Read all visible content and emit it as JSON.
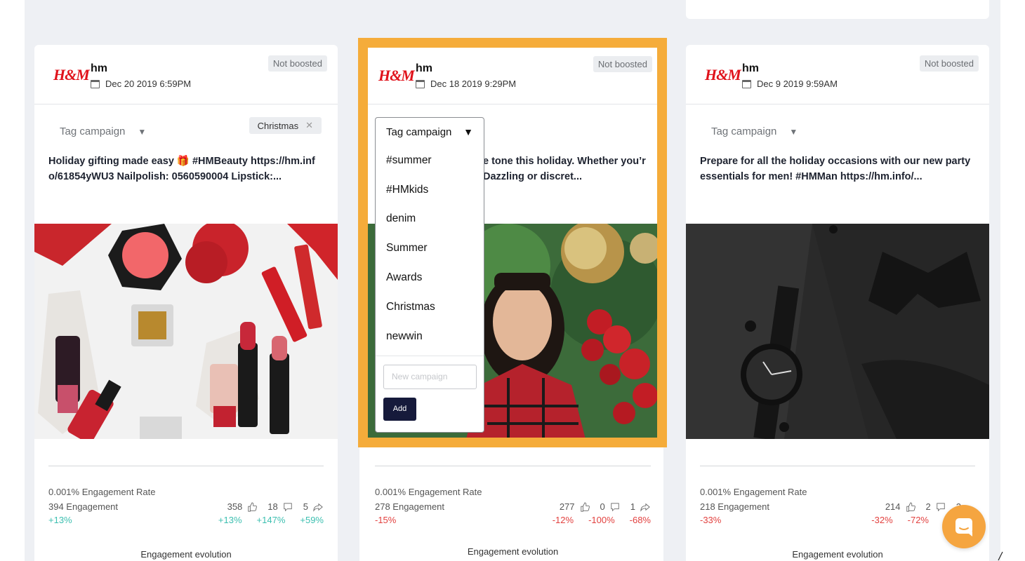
{
  "colors": {
    "accent": "#f5ac3a",
    "positive": "#3cbfb0",
    "negative": "#e2413f",
    "brand": "#e0121b",
    "button": "#161a3b"
  },
  "posts": [
    {
      "brand_logo": "H&M",
      "account": "hm",
      "date": "Dec 20 2019 6:59PM",
      "boost_status": "Not boosted",
      "tag_label": "Tag campaign",
      "tag_chip": "Christmas",
      "caption_line1": "Holiday gifting made easy 🎁  #HMBeauty https://hm.inf",
      "caption_line2": "o/61854yWU3 Nailpolish: 0560590004 Lipstick:...",
      "engagement_rate": "0.001% Engagement Rate",
      "engagement": "394 Engagement",
      "likes": "358",
      "comments": "18",
      "shares": "5",
      "engagement_change": "+13%",
      "likes_change": "+13%",
      "comments_change": "+147%",
      "shares_change": "+59%",
      "evolution_label": "Engagement evolution"
    },
    {
      "brand_logo": "H&M",
      "account": "hm",
      "date": "Dec 18 2019 9:29PM",
      "boost_status": "Not boosted",
      "tag_label": "Tag campaign",
      "caption_line1": "e tone this holiday. Whether you’r",
      "caption_line2": "Dazzling or discret...",
      "engagement_rate": "0.001% Engagement Rate",
      "engagement": "278 Engagement",
      "likes": "277",
      "comments": "0",
      "shares": "1",
      "engagement_change": "-15%",
      "likes_change": "-12%",
      "comments_change": "-100%",
      "shares_change": "-68%",
      "evolution_label": "Engagement evolution"
    },
    {
      "brand_logo": "H&M",
      "account": "hm",
      "date": "Dec 9 2019 9:59AM",
      "boost_status": "Not boosted",
      "tag_label": "Tag campaign",
      "caption_line1": "Prepare for all the holiday occasions with our new party",
      "caption_line2": "essentials for men! #HMMan https://hm.info/...",
      "engagement_rate": "0.001% Engagement Rate",
      "engagement": "218 Engagement",
      "likes": "214",
      "comments": "2",
      "shares": "2",
      "engagement_change": "-33%",
      "likes_change": "-32%",
      "comments_change": "-72%",
      "evolution_label": "Engagement evolution"
    }
  ],
  "dropdown": {
    "label": "Tag campaign",
    "options": [
      "#summer",
      "#HMkids",
      "denim",
      "Summer",
      "Awards",
      "Christmas",
      "newwin"
    ],
    "input_placeholder": "New campaign",
    "add_label": "Add"
  }
}
